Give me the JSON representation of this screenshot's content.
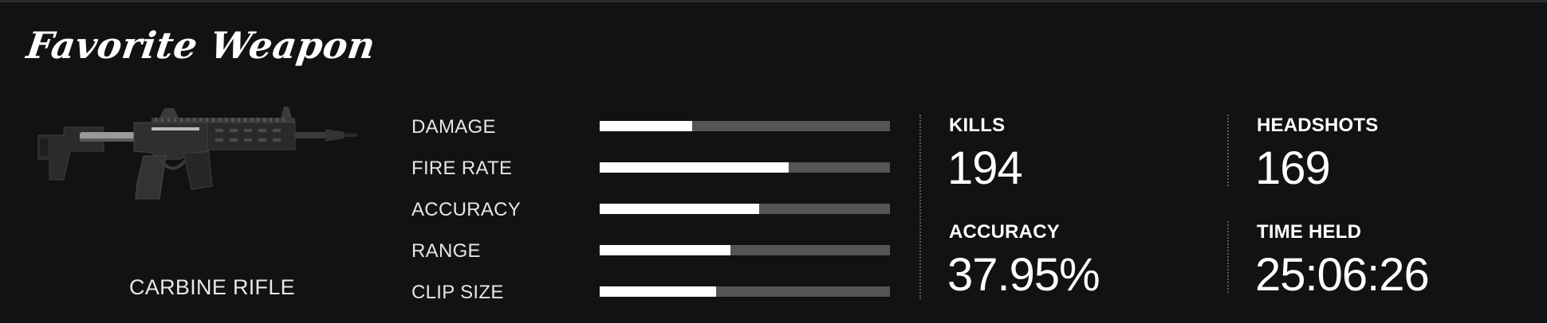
{
  "panel": {
    "title": "Favorite Weapon"
  },
  "weapon": {
    "name": "CARBINE RIFLE",
    "icon": "carbine-rifle-image"
  },
  "attributes": [
    {
      "label": "DAMAGE",
      "value_fraction": 0.32
    },
    {
      "label": "FIRE RATE",
      "value_fraction": 0.65
    },
    {
      "label": "ACCURACY",
      "value_fraction": 0.55
    },
    {
      "label": "RANGE",
      "value_fraction": 0.45
    },
    {
      "label": "CLIP SIZE",
      "value_fraction": 0.4
    }
  ],
  "stats": {
    "kills": {
      "label": "KILLS",
      "value": "194"
    },
    "headshots": {
      "label": "HEADSHOTS",
      "value": "169"
    },
    "accuracy": {
      "label": "ACCURACY",
      "value": "37.95%"
    },
    "time_held": {
      "label": "TIME HELD",
      "value": "25:06:26"
    }
  },
  "colors": {
    "background": "#121212",
    "bar_fill": "#ffffff",
    "bar_track": "#555555",
    "text": "#ffffff"
  }
}
